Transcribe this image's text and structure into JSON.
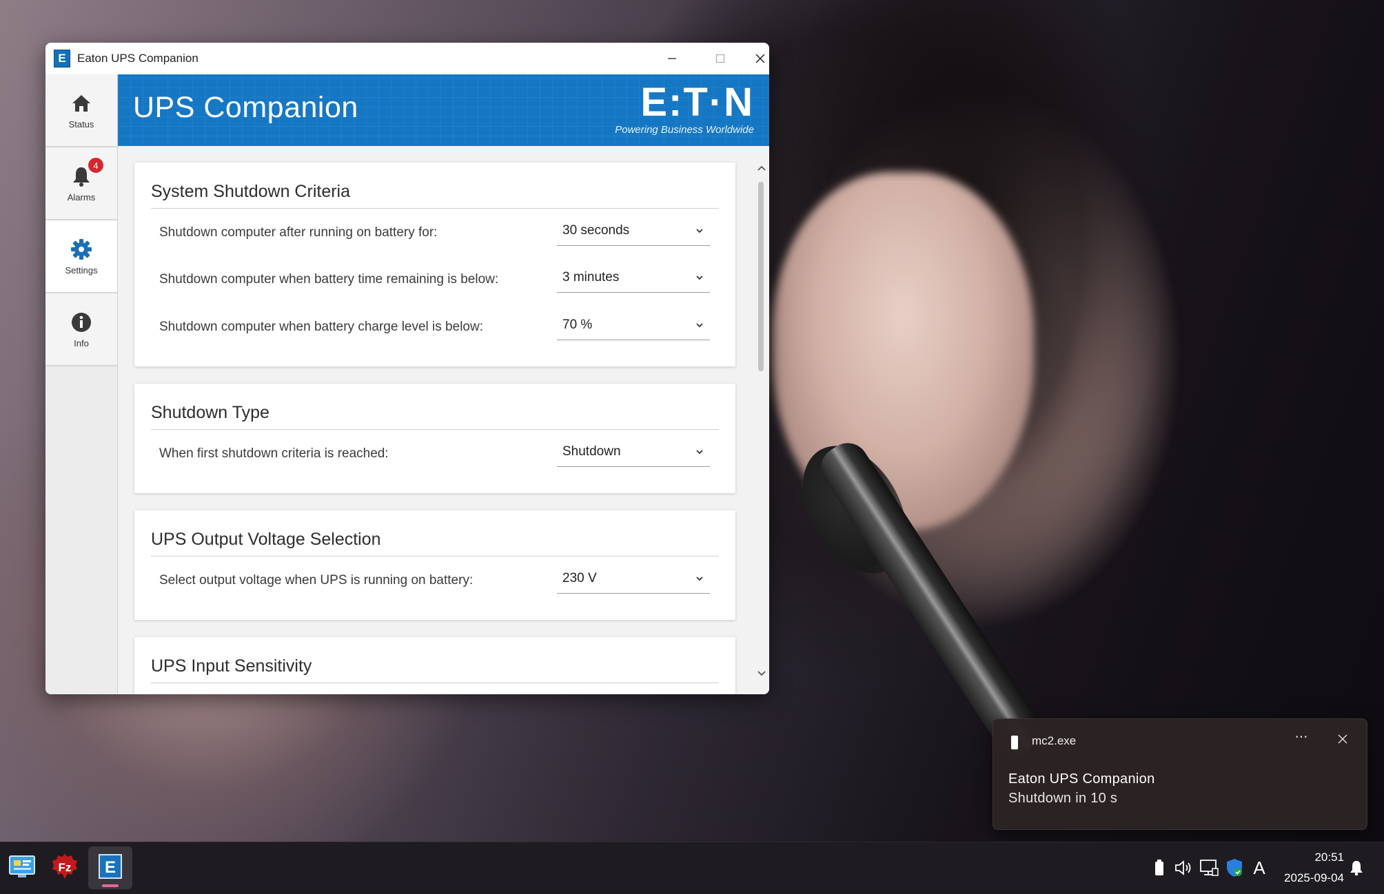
{
  "window": {
    "title": "Eaton UPS Companion",
    "icon_letter": "E",
    "controls": {
      "minimize": "—",
      "maximize": "☐",
      "close": "✕"
    }
  },
  "header": {
    "title": "UPS Companion",
    "logo_text": "E:T·N",
    "logo_tagline": "Powering Business Worldwide",
    "color": "#1577c4"
  },
  "sidebar": {
    "items": [
      {
        "label": "Status",
        "icon": "home-icon",
        "active": false
      },
      {
        "label": "Alarms",
        "icon": "bell-icon",
        "badge": "4",
        "active": false
      },
      {
        "label": "Settings",
        "icon": "gear-icon",
        "active": true
      },
      {
        "label": "Info",
        "icon": "info-icon",
        "active": false
      }
    ]
  },
  "sections": {
    "shutdown_criteria": {
      "title": "System Shutdown Criteria",
      "rows": [
        {
          "label": "Shutdown computer after running on battery for:",
          "value": "30 seconds"
        },
        {
          "label": "Shutdown computer when battery time remaining is below:",
          "value": "3 minutes"
        },
        {
          "label": "Shutdown computer when battery charge level is below:",
          "value": "70 %"
        }
      ]
    },
    "shutdown_type": {
      "title": "Shutdown Type",
      "rows": [
        {
          "label": "When first shutdown criteria is reached:",
          "value": "Shutdown"
        }
      ]
    },
    "output_voltage": {
      "title": "UPS Output Voltage Selection",
      "rows": [
        {
          "label": "Select output voltage when UPS is running on battery:",
          "value": "230 V"
        }
      ]
    },
    "input_sensitivity": {
      "title": "UPS Input Sensitivity"
    }
  },
  "notification": {
    "app": "mc2.exe",
    "more": "···",
    "title": "Eaton UPS Companion",
    "body": "Shutdown in 10 s"
  },
  "taskbar": {
    "apps": [
      {
        "name": "control-panel",
        "icon": "control-panel-icon"
      },
      {
        "name": "filezilla",
        "icon": "filezilla-icon",
        "letter": "Fz"
      },
      {
        "name": "eaton-ups-companion",
        "icon": "eaton-icon",
        "letter": "E",
        "active": true
      }
    ],
    "tray": {
      "ime": "A",
      "time": "20:51",
      "date": "2025-09-04"
    }
  },
  "colors": {
    "accent": "#1577c4",
    "badge": "#d7262f",
    "settings_icon": "#1a6fb7"
  }
}
